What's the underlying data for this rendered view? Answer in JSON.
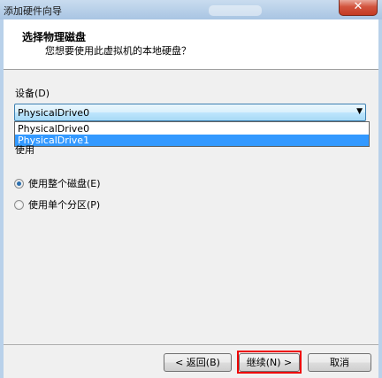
{
  "window": {
    "title": "添加硬件向导",
    "close_label": "✕"
  },
  "header": {
    "title": "选择物理磁盘",
    "subtitle": "您想要使用此虚拟机的本地硬盘？"
  },
  "device": {
    "label": "设备(D)",
    "selected": "PhysicalDrive0",
    "options": [
      "PhysicalDrive0",
      "PhysicalDrive1"
    ],
    "highlighted_option": "PhysicalDrive1"
  },
  "usage": {
    "label": "使用",
    "options": [
      {
        "label": "使用整个磁盘(E)",
        "checked": true
      },
      {
        "label": "使用单个分区(P)",
        "checked": false
      }
    ]
  },
  "buttons": {
    "back": "< 返回(B)",
    "next": "继续(N) >",
    "cancel": "取消"
  },
  "colors": {
    "highlight_border": "#e00000",
    "selection": "#3399ff"
  }
}
